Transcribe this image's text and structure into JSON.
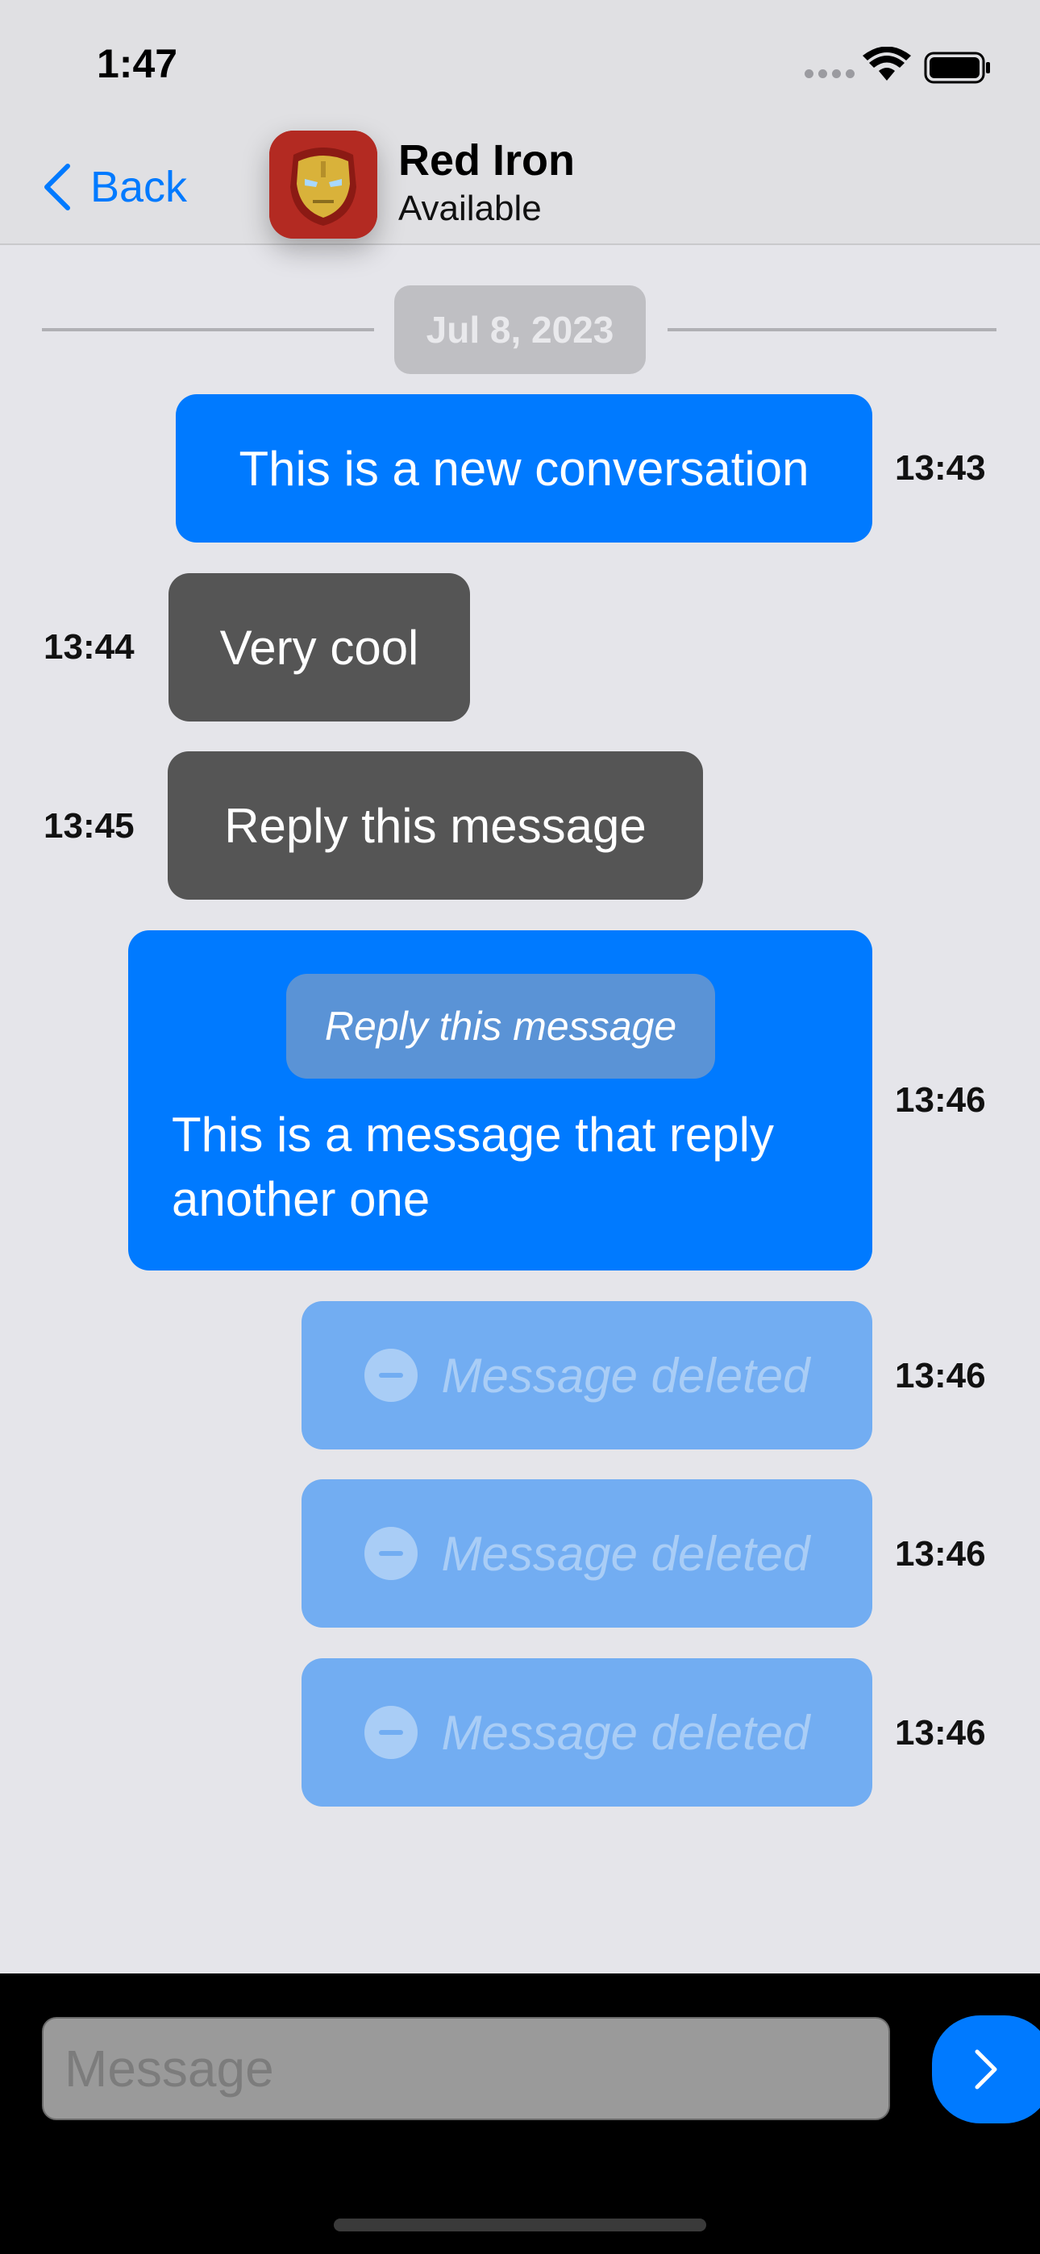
{
  "status_bar": {
    "time": "1:47"
  },
  "nav": {
    "back_label": "Back",
    "contact_name": "Red Iron",
    "contact_status": "Available"
  },
  "chat": {
    "date_separator": "Jul 8, 2023",
    "messages": [
      {
        "direction": "outgoing",
        "text": "This is a new conversation",
        "time": "13:43"
      },
      {
        "direction": "incoming",
        "text": "Very cool",
        "time": "13:44"
      },
      {
        "direction": "incoming",
        "text": "Reply this message",
        "time": "13:45"
      },
      {
        "direction": "outgoing",
        "quoted": "Reply this message",
        "text": "This is a message that reply another one",
        "time": "13:46"
      },
      {
        "direction": "outgoing",
        "deleted": true,
        "text": "Message deleted",
        "time": "13:46"
      },
      {
        "direction": "outgoing",
        "deleted": true,
        "text": "Message deleted",
        "time": "13:46"
      },
      {
        "direction": "outgoing",
        "deleted": true,
        "text": "Message deleted",
        "time": "13:46"
      }
    ]
  },
  "composer": {
    "placeholder": "Message"
  },
  "colors": {
    "accent": "#007aff",
    "incoming_bubble": "#555555",
    "deleted_bubble": "#72adf2",
    "background": "#e5e5ea",
    "avatar_bg": "#b32a22"
  },
  "icons": {
    "back": "chevron-left-icon",
    "send": "chevron-right-icon",
    "deleted": "minus-circle-icon",
    "avatar": "iron-man-helmet-icon"
  }
}
